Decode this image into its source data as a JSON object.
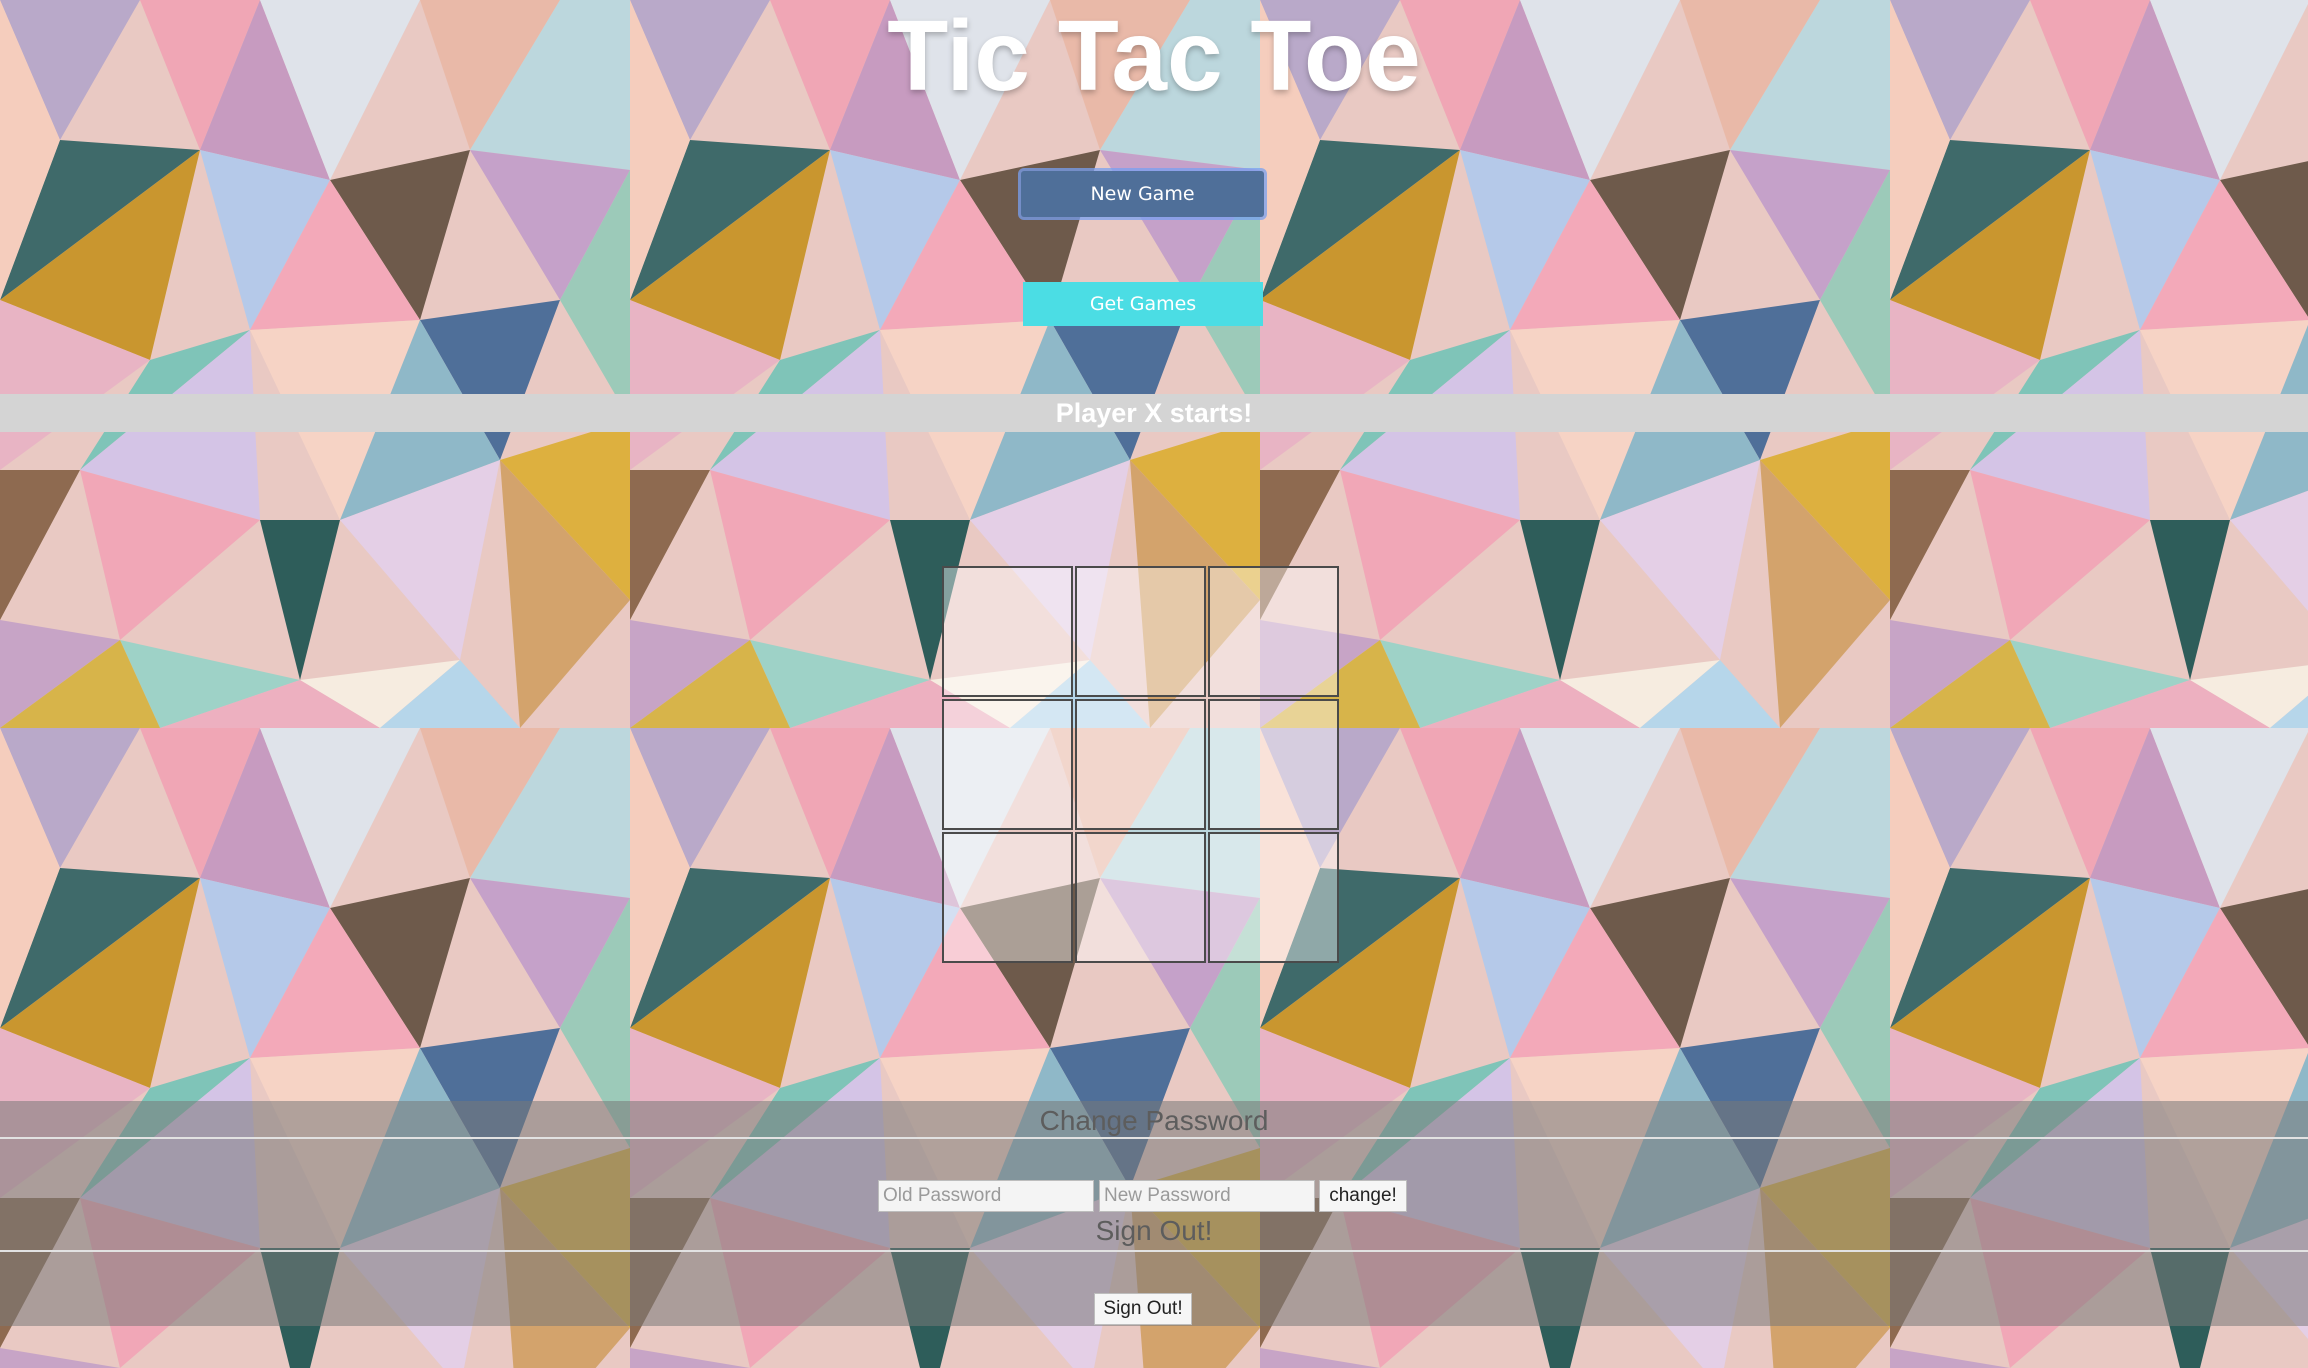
{
  "page": {
    "title": "Tic Tac Toe"
  },
  "controls": {
    "new_game_label": "New Game",
    "get_games_label": "Get Games"
  },
  "status": {
    "message": "Player X starts!"
  },
  "board": {
    "cells": [
      "",
      "",
      "",
      "",
      "",
      "",
      "",
      "",
      ""
    ]
  },
  "account": {
    "change_password_heading": "Change Password",
    "old_password_placeholder": "Old Password",
    "new_password_placeholder": "New Password",
    "change_button_label": "change!",
    "sign_out_heading": "Sign Out!",
    "sign_out_button_label": "Sign Out!"
  },
  "colors": {
    "new_game_button": "#4f6f99",
    "get_games_button": "#4bdde4",
    "status_bar": "#d4d4d4"
  }
}
